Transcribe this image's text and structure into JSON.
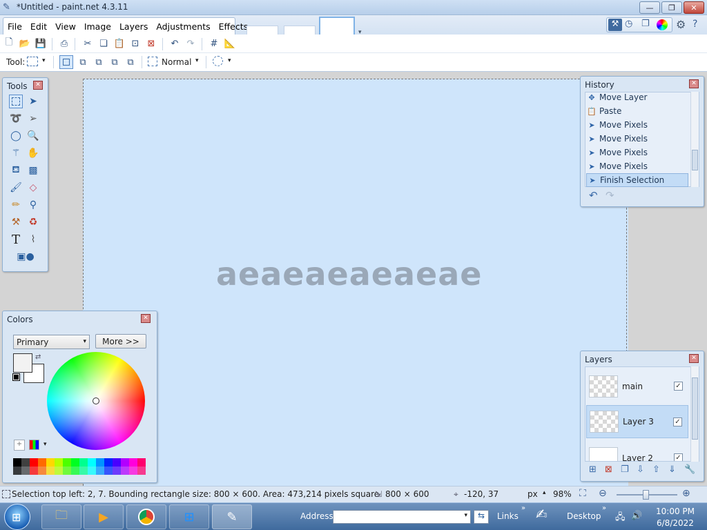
{
  "window": {
    "title": "*Untitled - paint.net 4.3.11"
  },
  "menu": [
    "File",
    "Edit",
    "View",
    "Image",
    "Layers",
    "Adjustments",
    "Effects"
  ],
  "toolbar": {
    "tool_label": "Tool:",
    "blend_mode": "Normal"
  },
  "canvas": {
    "text": "aeaeaeaeaeae"
  },
  "tools_panel": {
    "title": "Tools",
    "close": "✕"
  },
  "history": {
    "title": "History",
    "items": [
      "Move Layer",
      "Paste",
      "Move Pixels",
      "Move Pixels",
      "Move Pixels",
      "Move Pixels",
      "Finish Selection"
    ],
    "selected_index": 6
  },
  "colors": {
    "title": "Colors",
    "select_value": "Primary",
    "more_button": "More >>"
  },
  "layers": {
    "title": "Layers",
    "items": [
      {
        "name": "main",
        "visible": true
      },
      {
        "name": "Layer 3",
        "visible": true
      },
      {
        "name": "Layer 2",
        "visible": true
      }
    ],
    "selected_index": 1
  },
  "status": {
    "selection": "Selection top left: 2, 7. Bounding rectangle size: 800 × 600. Area: 473,214 pixels square",
    "image_size": "800 × 600",
    "cursor_position": "-120, 37",
    "units": "px",
    "zoom": "98%"
  },
  "taskbar": {
    "address_label": "Address",
    "links_label": "Links",
    "desktop_label": "Desktop",
    "time": "10:00 PM",
    "date": "6/8/2022"
  },
  "colors_palette": [
    "#000000",
    "#404040",
    "#ff0000",
    "#ff6a00",
    "#ffd800",
    "#b6ff00",
    "#4cff00",
    "#00ff21",
    "#00ff90",
    "#00ffff",
    "#0094ff",
    "#0026ff",
    "#4800ff",
    "#b200ff",
    "#ff00dc",
    "#ff006e"
  ]
}
